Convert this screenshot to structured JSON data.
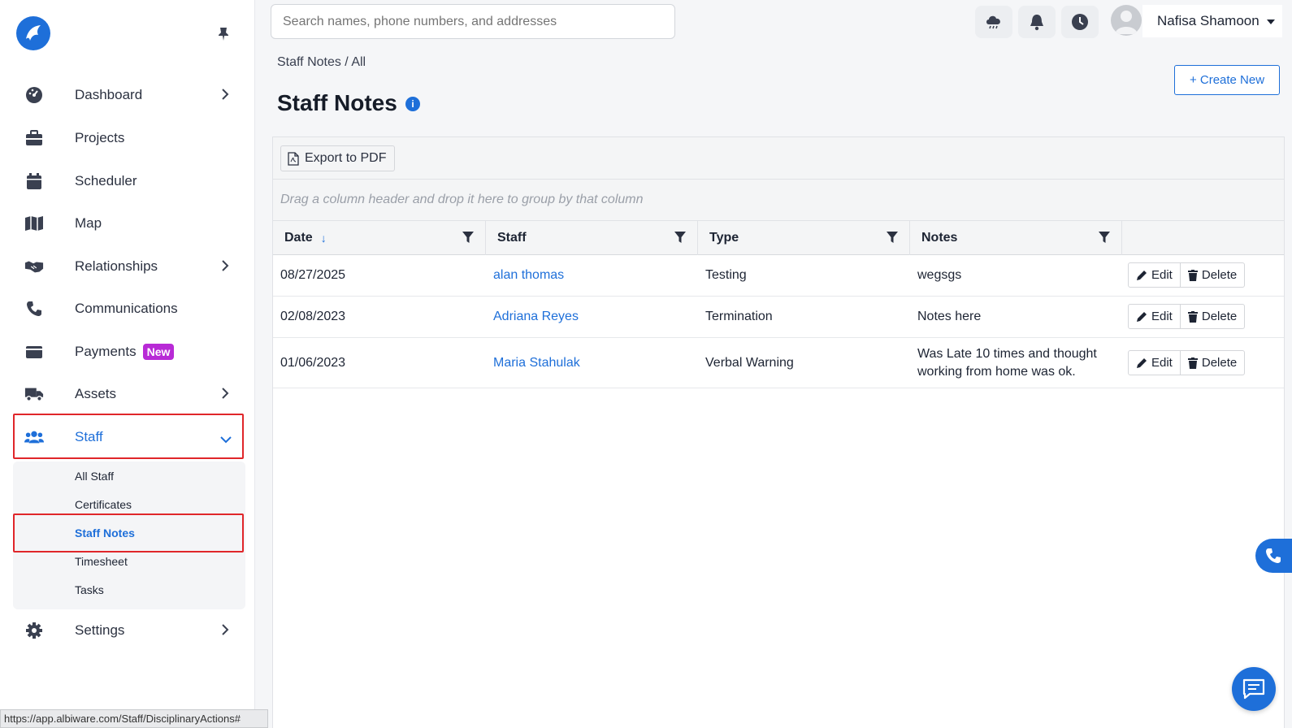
{
  "sidebar": {
    "items": [
      {
        "label": "Dashboard",
        "icon": "dashboard-gauge-icon",
        "has_chevron": true
      },
      {
        "label": "Projects",
        "icon": "briefcase-icon",
        "has_chevron": false
      },
      {
        "label": "Scheduler",
        "icon": "calendar-icon",
        "has_chevron": false
      },
      {
        "label": "Map",
        "icon": "map-icon",
        "has_chevron": false
      },
      {
        "label": "Relationships",
        "icon": "handshake-icon",
        "has_chevron": true
      },
      {
        "label": "Communications",
        "icon": "phone-icon",
        "has_chevron": false
      },
      {
        "label": "Payments",
        "icon": "wallet-icon",
        "has_chevron": false,
        "badge": "New"
      },
      {
        "label": "Assets",
        "icon": "truck-icon",
        "has_chevron": true
      },
      {
        "label": "Staff",
        "icon": "users-icon",
        "has_chevron": true,
        "active": true
      },
      {
        "label": "Settings",
        "icon": "gear-icon",
        "has_chevron": true
      }
    ],
    "staff_submenu": [
      "All Staff",
      "Certificates",
      "Staff Notes",
      "Timesheet",
      "Tasks"
    ],
    "active_submenu": "Staff Notes"
  },
  "statusbar": {
    "url": "https://app.albiware.com/Staff/DisciplinaryActions#"
  },
  "topbar": {
    "search_placeholder": "Search names, phone numbers, and addresses",
    "user_name": "Nafisa Shamoon"
  },
  "page": {
    "breadcrumb": "Staff Notes / All",
    "title": "Staff Notes",
    "create_button": "+ Create New"
  },
  "grid": {
    "export_label": "Export to PDF",
    "group_panel_text": "Drag a column header and drop it here to group by that column",
    "columns": [
      "Date",
      "Staff",
      "Type",
      "Notes"
    ],
    "rows": [
      {
        "date": "08/27/2025",
        "staff": "alan thomas",
        "type": "Testing",
        "notes": "wegsgs"
      },
      {
        "date": "02/08/2023",
        "staff": "Adriana Reyes",
        "type": "Termination",
        "notes": "Notes here"
      },
      {
        "date": "01/06/2023",
        "staff": "Maria Stahulak",
        "type": "Verbal Warning",
        "notes": "Was Late 10 times and thought working from home was ok."
      }
    ],
    "edit_label": "Edit",
    "delete_label": "Delete"
  },
  "colors": {
    "accent": "#1e6fd9",
    "badge": "#b82ad6",
    "highlight": "#e0262a"
  }
}
